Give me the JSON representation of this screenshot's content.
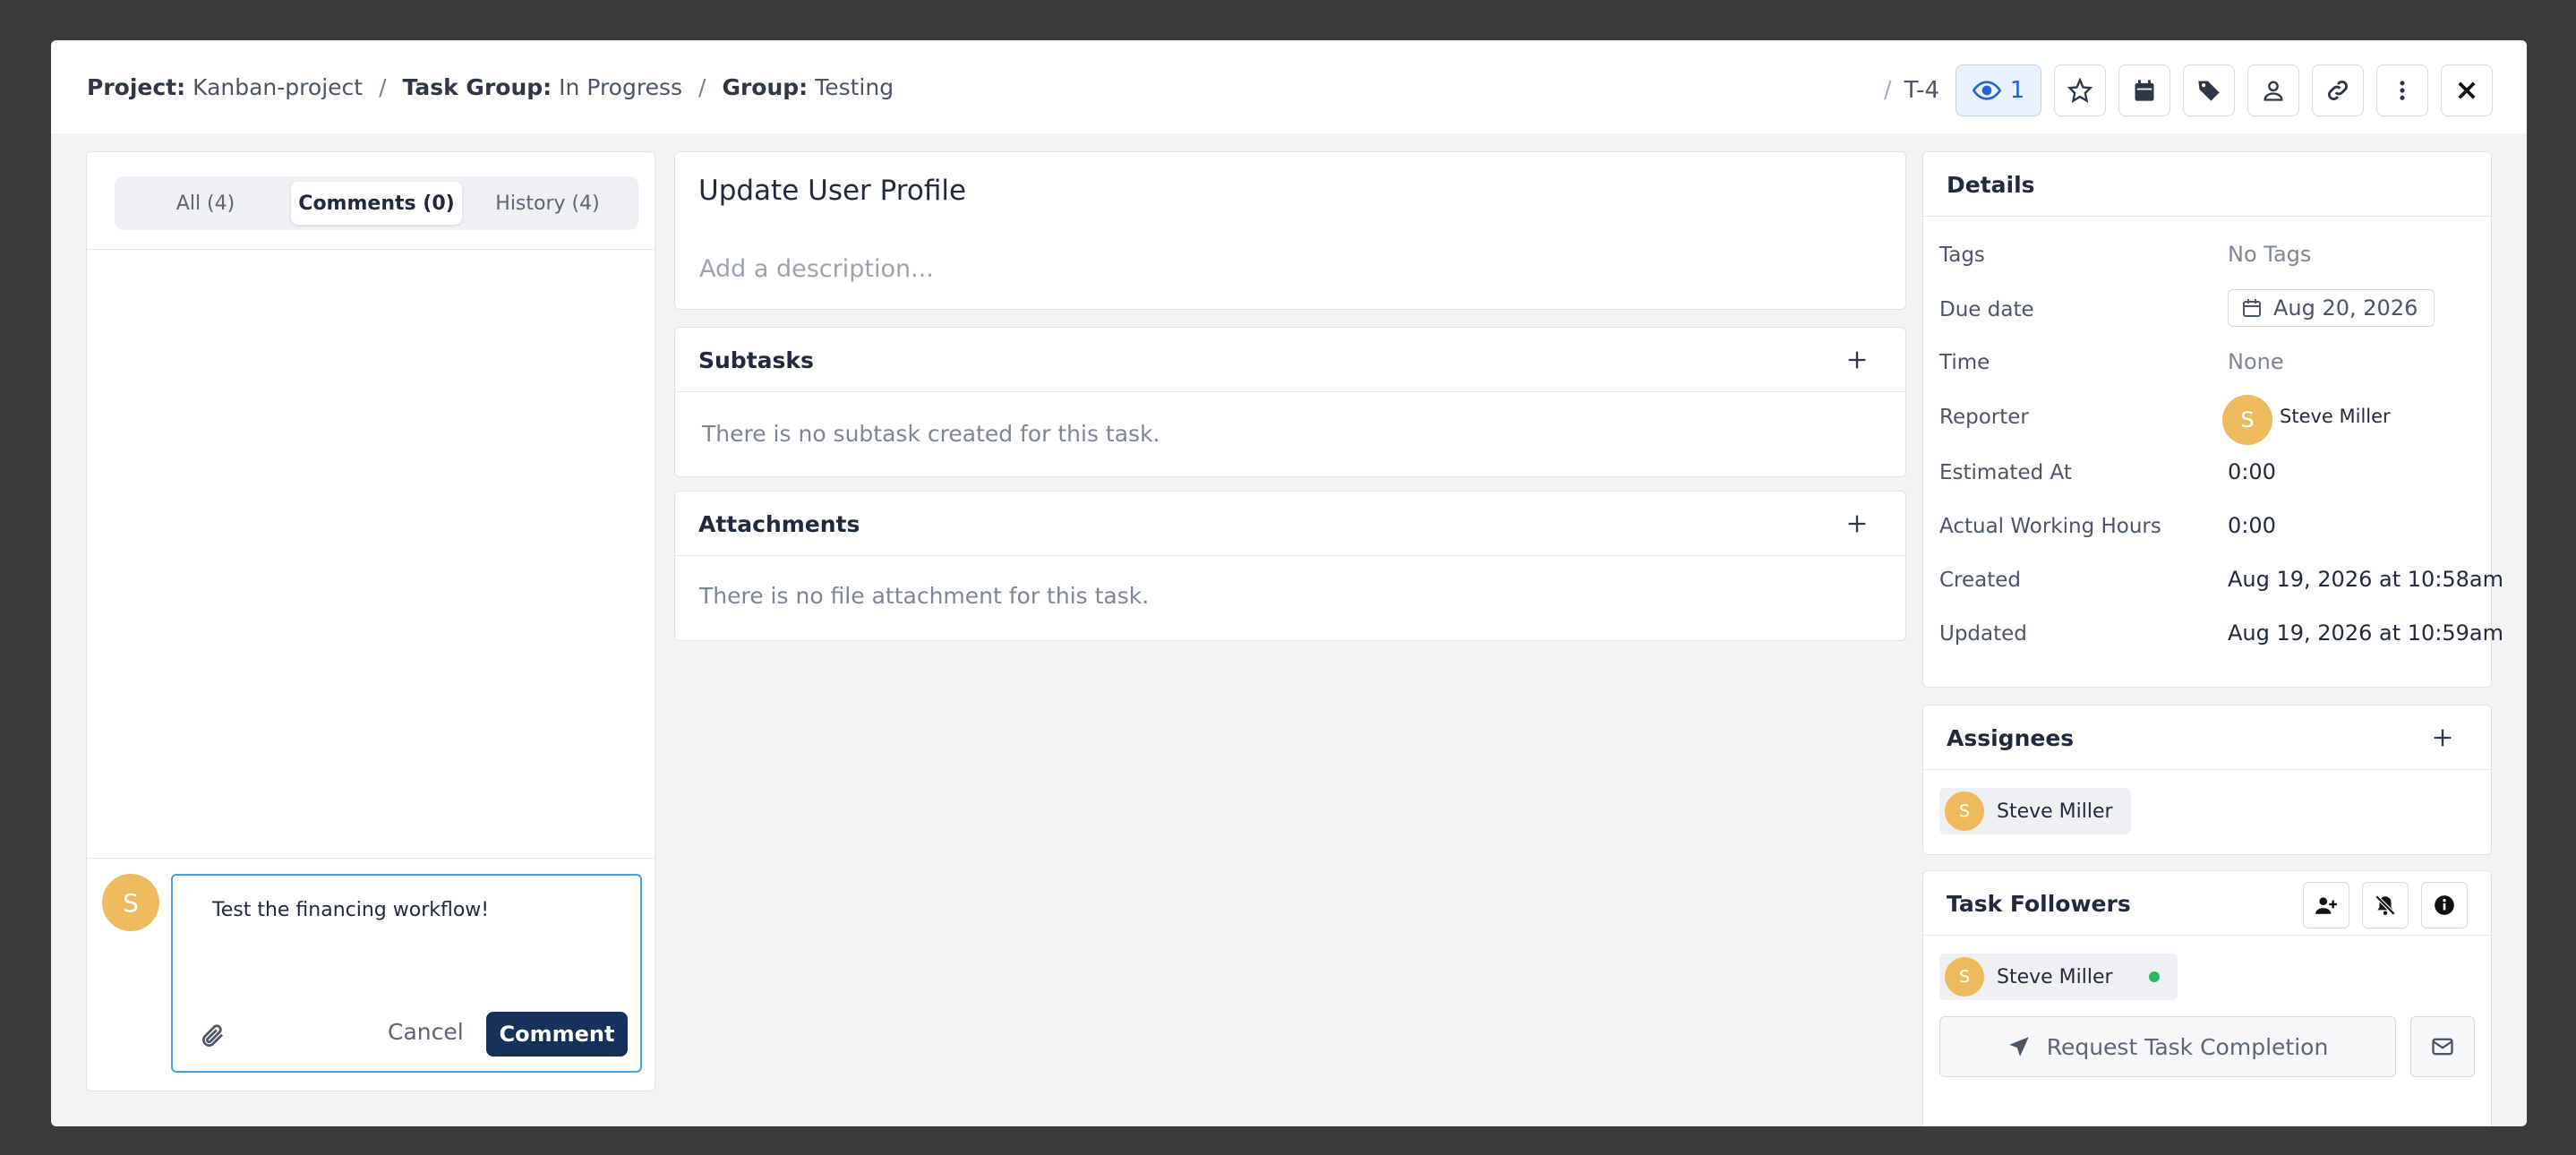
{
  "breadcrumb": {
    "project_label": "Project:",
    "project_value": "Kanban-project",
    "task_group_label": "Task Group:",
    "task_group_value": "In Progress",
    "group_label": "Group:",
    "group_value": "Testing",
    "separator": "/"
  },
  "header": {
    "task_id_sep": "/",
    "task_id": "T-4",
    "watch_count": "1"
  },
  "activity": {
    "tabs": [
      {
        "label": "All (4)",
        "active": false
      },
      {
        "label": "Comments (0)",
        "active": true
      },
      {
        "label": "History (4)",
        "active": false
      }
    ],
    "avatar_initial": "S",
    "comment_text": "Test the financing workflow!",
    "cancel_label": "Cancel",
    "comment_label": "Comment"
  },
  "task": {
    "title": "Update User Profile",
    "description_placeholder": "Add a description..."
  },
  "subtasks": {
    "title": "Subtasks",
    "empty": "There is no subtask created for this task."
  },
  "attachments": {
    "title": "Attachments",
    "empty": "There is no file attachment for this task."
  },
  "details": {
    "title": "Details",
    "tags_label": "Tags",
    "tags_value": "No Tags",
    "due_label": "Due date",
    "due_value": "Aug 20, 2026",
    "time_label": "Time",
    "time_value": "None",
    "reporter_label": "Reporter",
    "reporter_initial": "S",
    "reporter_name": "Steve Miller",
    "estimated_label": "Estimated At",
    "estimated_value": "0:00",
    "actual_label": "Actual Working Hours",
    "actual_value": "0:00",
    "created_label": "Created",
    "created_value": "Aug 19, 2026 at 10:58am",
    "updated_label": "Updated",
    "updated_value": "Aug 19, 2026 at 10:59am"
  },
  "assignees": {
    "title": "Assignees",
    "items": [
      {
        "initial": "S",
        "name": "Steve Miller"
      }
    ]
  },
  "followers": {
    "title": "Task Followers",
    "items": [
      {
        "initial": "S",
        "name": "Steve Miller"
      }
    ],
    "request_label": "Request Task Completion"
  },
  "icons": {
    "watch": "eye-icon",
    "favorite": "star-icon",
    "calendar": "calendar-icon",
    "tag": "tag-icon",
    "user": "user-icon",
    "link": "link-icon",
    "more": "more-vertical-icon",
    "close": "close-icon",
    "attach": "paperclip-icon",
    "add": "plus-icon",
    "add_follower": "user-plus-icon",
    "mute": "bell-off-icon",
    "info": "info-icon",
    "send": "send-icon",
    "mail": "mail-icon"
  },
  "colors": {
    "primary": "#15325c",
    "accent": "#2563c9",
    "avatar": "#edbb5d",
    "online": "#2ab860"
  }
}
